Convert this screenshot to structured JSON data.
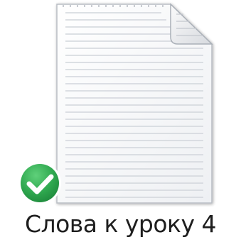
{
  "file": {
    "name": "Слова к уроку 4",
    "icon": "text-document-icon",
    "status_icon": "sync-ok-checkmark-icon",
    "status_color": "#2fa84f"
  }
}
